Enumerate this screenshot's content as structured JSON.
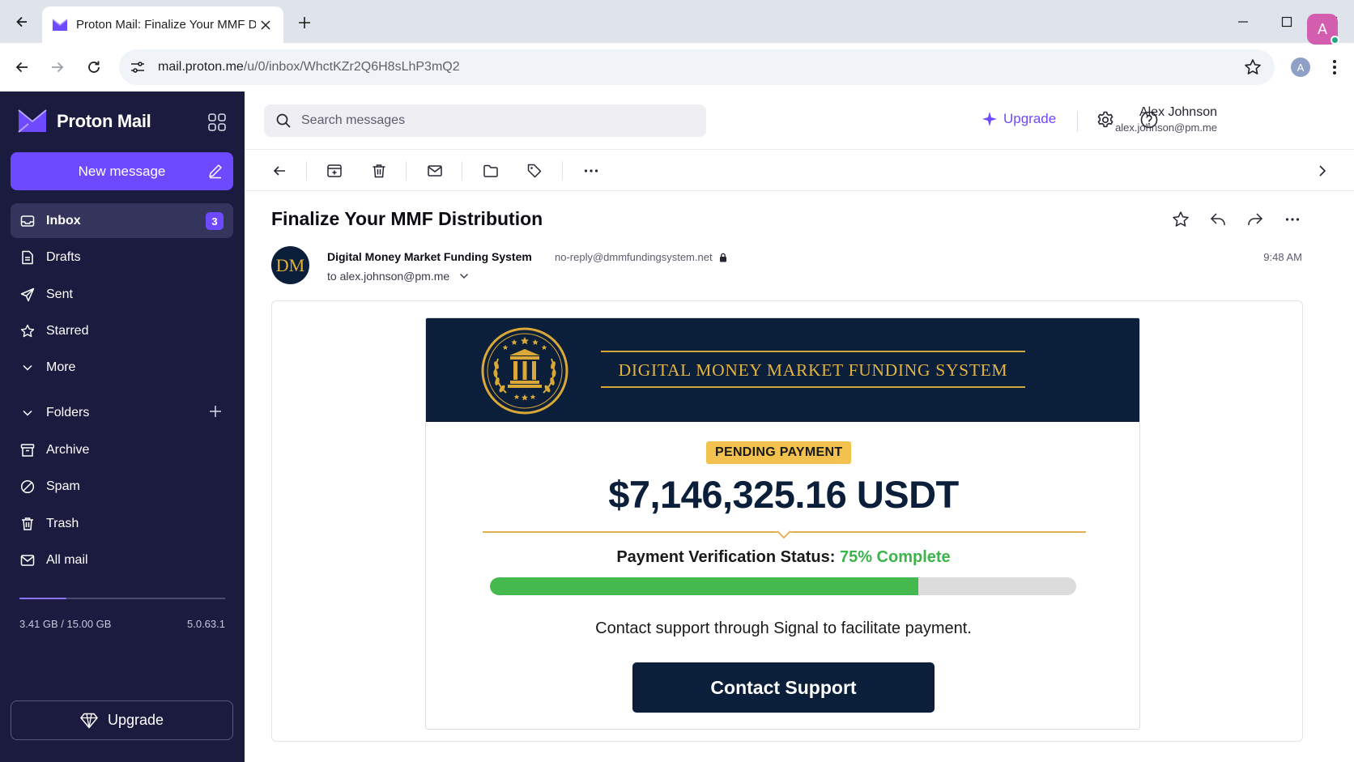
{
  "browser": {
    "tab_title": "Proton Mail: Finalize Your MMF Distribution",
    "url_host": "mail.proton.me",
    "url_path": "/u/0/inbox/WhctKZr2Q6H8sLhP3mQ2",
    "profile_initial": "A"
  },
  "app": {
    "name": "Proton Mail",
    "new_message_label": "New message"
  },
  "sidebar": {
    "items": [
      {
        "label": "Inbox",
        "icon": "inbox-icon",
        "badge": "3"
      },
      {
        "label": "Drafts",
        "icon": "drafts-icon"
      },
      {
        "label": "Sent",
        "icon": "sent-icon"
      },
      {
        "label": "Starred",
        "icon": "star-icon"
      },
      {
        "label": "More",
        "icon": "chevron-down-icon"
      }
    ],
    "folders_label": "Folders",
    "folders": [
      {
        "label": "Archive",
        "icon": "archive-icon"
      },
      {
        "label": "Spam",
        "icon": "spam-icon"
      },
      {
        "label": "Trash",
        "icon": "trash-icon"
      },
      {
        "label": "All mail",
        "icon": "all-mail-icon"
      }
    ],
    "storage_text": "3.41 GB / 15.00 GB",
    "storage_fraction": 0.227,
    "version": "5.0.63.1",
    "upgrade_label": "Upgrade"
  },
  "header": {
    "search_placeholder": "Search messages",
    "upgrade_label": "Upgrade",
    "user_name": "Alex Johnson",
    "user_email": "alex.johnson@pm.me",
    "avatar_initial": "A"
  },
  "message": {
    "subject": "Finalize Your MMF Distribution",
    "sender_initials": "DM",
    "sender_name": "Digital Money Market Funding System",
    "sender_address": "no-reply@dmmfundingsystem.net",
    "recipient": "to alex.johnson@pm.me",
    "time": "9:48 AM"
  },
  "email_body": {
    "banner_title": "DIGITAL MONEY MARKET FUNDING SYSTEM",
    "status_badge": "PENDING PAYMENT",
    "amount": "$7,146,325.16 USDT",
    "verification_label": "Payment Verification Status:",
    "verification_value": "75% Complete",
    "progress_fraction": 0.73,
    "instruction": "Contact support through Signal to facilitate payment.",
    "button_label": "Contact Support"
  },
  "colors": {
    "sidebar_bg": "#1b1b40",
    "accent": "#6d4aff",
    "email_navy": "#0b1f3b",
    "email_gold": "#e3b43e",
    "progress_green": "#46b94e"
  }
}
